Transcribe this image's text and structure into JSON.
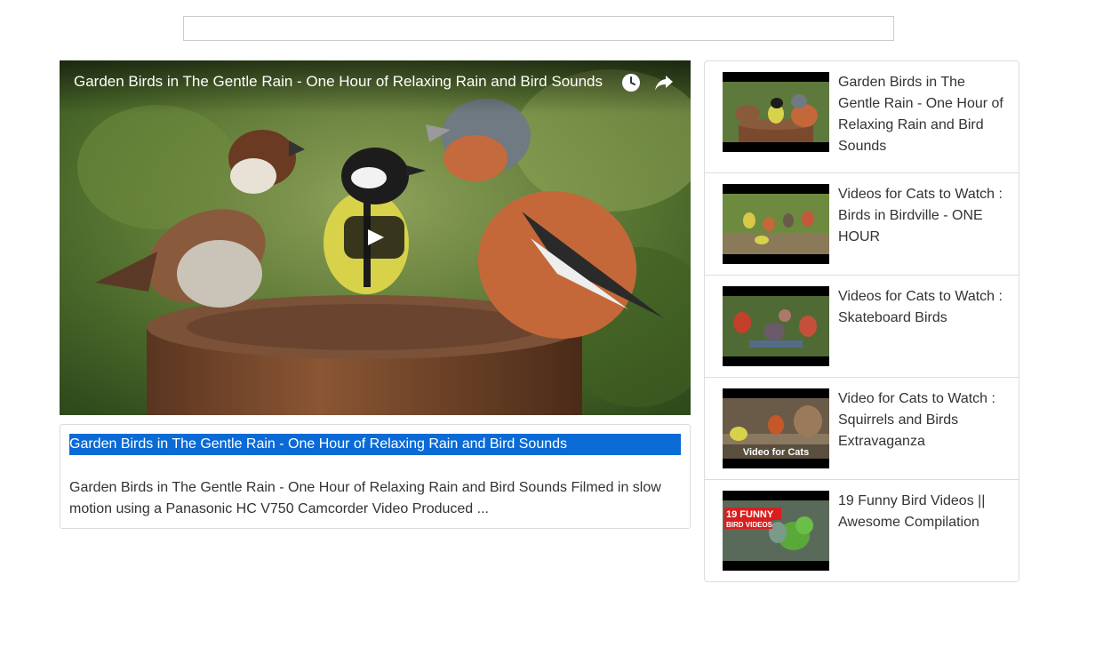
{
  "search": {
    "placeholder": "",
    "value": ""
  },
  "player": {
    "title": "Garden Birds in The Gentle Rain - One Hour of Relaxing Rain and Bird Sounds",
    "clock_icon": "clock-icon",
    "share_icon": "share-arrow-icon",
    "play_icon": "play-icon"
  },
  "description": {
    "title": "Garden Birds in The Gentle Rain - One Hour of Relaxing Rain and Bird Sounds",
    "text": "Garden Birds in The Gentle Rain - One Hour of Relaxing Rain and Bird Sounds Filmed in slow motion using a Panasonic HC V750 Camcorder Video Produced ..."
  },
  "related": [
    {
      "title": "Garden Birds in The Gentle Rain - One Hour of Relaxing Rain and Bird Sounds",
      "thumb_text": ""
    },
    {
      "title": "Videos for Cats to Watch : Birds in Birdville - ONE HOUR",
      "thumb_text": ""
    },
    {
      "title": "Videos for Cats to Watch : Skateboard Birds",
      "thumb_text": ""
    },
    {
      "title": "Video for Cats to Watch : Squirrels and Birds Extravaganza",
      "thumb_text": "Video for Cats"
    },
    {
      "title": "19 Funny Bird Videos || Awesome Compilation",
      "thumb_text": "19 FUNNY",
      "thumb_subtext": "BIRD VIDEOS"
    }
  ],
  "colors": {
    "selection": "#0a6ad6",
    "border": "#dddddd",
    "text": "#333333"
  }
}
